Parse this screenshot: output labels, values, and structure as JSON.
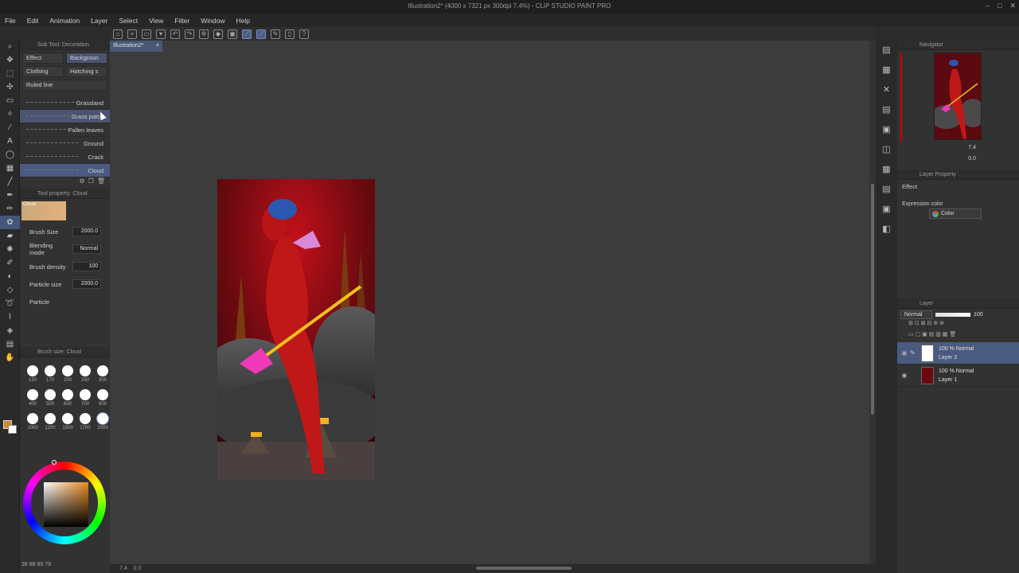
{
  "window": {
    "title": "Illustration2* (4000 x 7321 px 300dpi 7.4%) - CLIP STUDIO PAINT PRO"
  },
  "menu": [
    "File",
    "Edit",
    "Animation",
    "Layer",
    "Select",
    "View",
    "Filter",
    "Window",
    "Help"
  ],
  "subtool_panel": {
    "title": "Sub Tool: Decoration",
    "tabs": [
      "Effect",
      "Backgroun",
      "Clothing",
      "Hatching s"
    ],
    "ruled_line": "Ruled line",
    "brushes": [
      "Grassland",
      "Grass patch",
      "Fallen leaves",
      "Ground",
      "Crack",
      "Cloud"
    ],
    "active_brush": "Grass patch"
  },
  "tool_property": {
    "title": "Tool property: Cloud",
    "preview_label": "Cloud",
    "brush_size_label": "Brush Size",
    "brush_size_value": "2000.0",
    "blending_label": "Blending mode",
    "blending_value": "Normal",
    "density_label": "Brush density",
    "density_value": "100",
    "particle_size_label": "Particle size",
    "particle_size_value": "2000.0",
    "particle_label": "Particle"
  },
  "brush_size_panel": {
    "title": "Brush size: Cloud",
    "sizes": [
      "150",
      "170",
      "200",
      "250",
      "300",
      "400",
      "500",
      "600",
      "700",
      "800",
      "1000",
      "1200",
      "1500",
      "1700",
      "2000"
    ],
    "selected": "2000"
  },
  "color_readout": "36  88  85  79",
  "document_tab": "Illustration2*",
  "navigator": {
    "title": "Navigator",
    "zoom": "7.4",
    "angle": "0.0"
  },
  "layer_property": {
    "title": "Layer Property",
    "effect_label": "Effect",
    "expression_label": "Expression color",
    "expression_value": "Color"
  },
  "layer_panel": {
    "title": "Layer",
    "blend_mode": "Normal",
    "opacity": "100",
    "layers": [
      {
        "name": "Layer 2",
        "info": "100 % Normal",
        "selected": true
      },
      {
        "name": "Layer 1",
        "info": "100 % Normal",
        "selected": false
      }
    ]
  },
  "statusbar": {
    "zoom": "7.4",
    "angle": "0.0"
  },
  "colors": {
    "accent": "#4b5a80",
    "foreground": "#d48a2c"
  }
}
